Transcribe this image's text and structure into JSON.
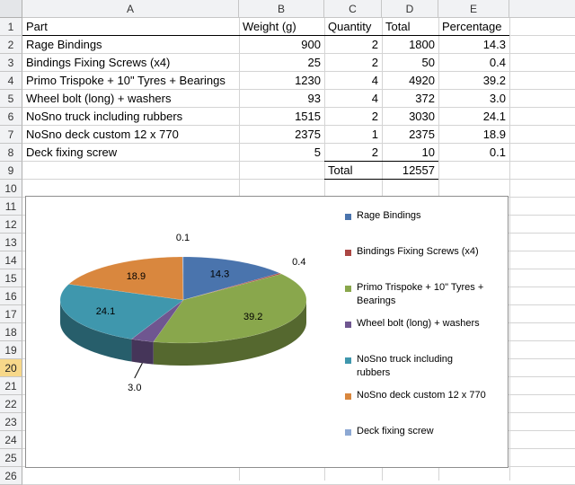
{
  "sheet": {
    "columns": [
      "A",
      "B",
      "C",
      "D",
      "E"
    ],
    "rows": [
      "1",
      "2",
      "3",
      "4",
      "5",
      "6",
      "7",
      "8",
      "9",
      "10",
      "11",
      "12",
      "13",
      "14",
      "15",
      "16",
      "17",
      "18",
      "19",
      "20",
      "21",
      "22",
      "23",
      "24",
      "25",
      "26"
    ],
    "selected_row": "20",
    "headers": {
      "part": "Part",
      "weight": "Weight (g)",
      "quantity": "Quantity",
      "total": "Total",
      "percentage": "Percentage"
    },
    "items": [
      {
        "part": "Rage Bindings",
        "weight": "900",
        "quantity": "2",
        "total": "1800",
        "percentage": "14.3"
      },
      {
        "part": "Bindings Fixing Screws (x4)",
        "weight": "25",
        "quantity": "2",
        "total": "50",
        "percentage": "0.4"
      },
      {
        "part": "Primo Trispoke + 10\" Tyres + Bearings",
        "weight": "1230",
        "quantity": "4",
        "total": "4920",
        "percentage": "39.2"
      },
      {
        "part": "Wheel bolt (long) + washers",
        "weight": "93",
        "quantity": "4",
        "total": "372",
        "percentage": "3.0"
      },
      {
        "part": "NoSno truck including rubbers",
        "weight": "1515",
        "quantity": "2",
        "total": "3030",
        "percentage": "24.1"
      },
      {
        "part": "NoSno deck custom 12 x 770",
        "weight": "2375",
        "quantity": "1",
        "total": "2375",
        "percentage": "18.9"
      },
      {
        "part": "Deck fixing screw",
        "weight": "5",
        "quantity": "2",
        "total": "10",
        "percentage": "0.1"
      }
    ],
    "total_label": "Total",
    "grand_total": "12557"
  },
  "chart_data": {
    "type": "pie",
    "style": "3d",
    "legend_position": "right",
    "categories": [
      "Rage Bindings",
      "Bindings Fixing Screws (x4)",
      "Primo Trispoke + 10\" Tyres + Bearings",
      "Wheel bolt (long) + washers",
      "NoSno truck including rubbers",
      "NoSno deck custom 12 x 770",
      "Deck fixing screw"
    ],
    "legend_labels": [
      [
        "Rage Bindings"
      ],
      [
        "Bindings Fixing Screws (x4)"
      ],
      [
        "Primo Trispoke + 10\" Tyres +",
        "Bearings"
      ],
      [
        "Wheel bolt (long) + washers"
      ],
      [
        "NoSno truck including",
        "rubbers"
      ],
      [
        "NoSno deck custom 12 x 770"
      ],
      [
        "Deck fixing screw"
      ]
    ],
    "values": [
      14.3,
      0.4,
      39.2,
      3.0,
      24.1,
      18.9,
      0.1
    ],
    "data_labels": [
      "14.3",
      "0.4",
      "39.2",
      "3.0",
      "24.1",
      "18.9",
      "0.1"
    ],
    "colors": [
      "#4a74ad",
      "#ab4744",
      "#89a74c",
      "#6f5690",
      "#3f97ad",
      "#d9873e",
      "#8da8d3"
    ]
  }
}
